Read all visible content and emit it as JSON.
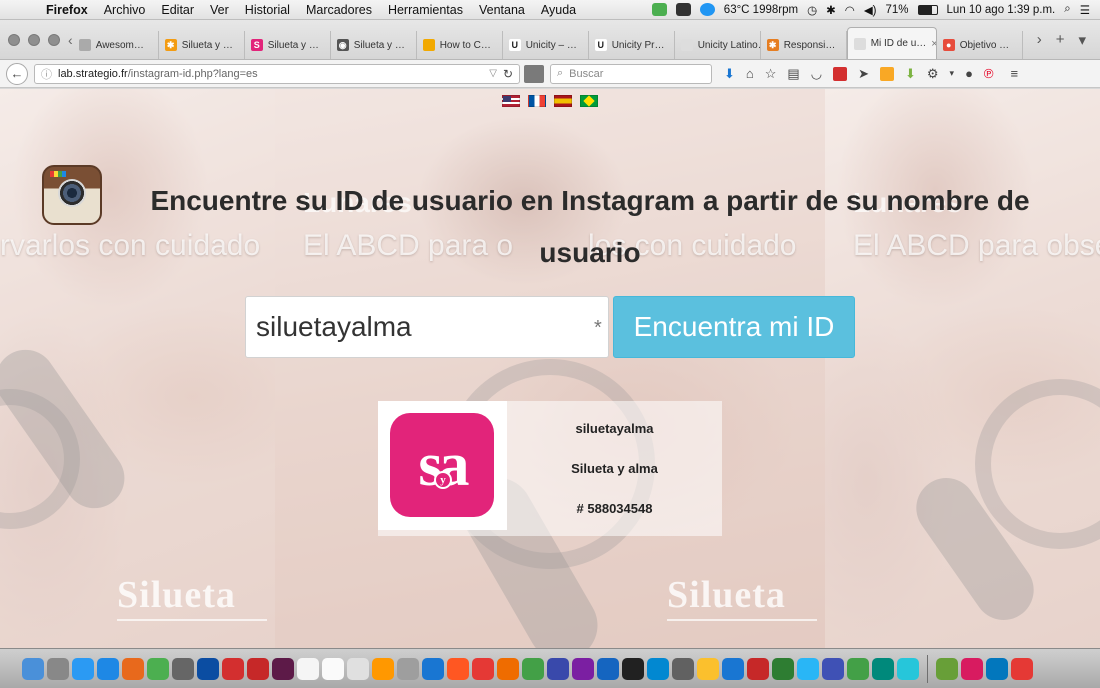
{
  "menubar": {
    "app": "Firefox",
    "items": [
      "Archivo",
      "Editar",
      "Ver",
      "Historial",
      "Marcadores",
      "Herramientas",
      "Ventana",
      "Ayuda"
    ],
    "temp": "63°C 1998rpm",
    "battery": "71%",
    "clock": "Lun 10 ago  1:39 p.m."
  },
  "tabs": [
    {
      "label": "Awesom…",
      "color": "#aaaaaa",
      "glyph": ""
    },
    {
      "label": "Silueta y …",
      "color": "#f39c12",
      "glyph": "✱"
    },
    {
      "label": "Silueta y …",
      "color": "#e2247a",
      "glyph": "S"
    },
    {
      "label": "Silueta y …",
      "color": "#555555",
      "glyph": "◉"
    },
    {
      "label": "How to C…",
      "color": "#f2a900",
      "glyph": ""
    },
    {
      "label": "Unicity – …",
      "color": "#ffffff",
      "glyph": "U"
    },
    {
      "label": "Unicity Pr…",
      "color": "#ffffff",
      "glyph": "U"
    },
    {
      "label": "Unicity Latino…",
      "color": "#dddddd",
      "glyph": ""
    },
    {
      "label": "Responsi…",
      "color": "#e67e22",
      "glyph": "✱"
    },
    {
      "label": "Mi ID de u…",
      "color": "#dddddd",
      "glyph": "",
      "active": true
    },
    {
      "label": "Objetivo …",
      "color": "#e74c3c",
      "glyph": "●"
    }
  ],
  "nav": {
    "url_host": "lab.strategio.fr",
    "url_path": "/instagram-id.php?lang=es",
    "search_placeholder": "Buscar"
  },
  "page": {
    "bg_word_left": "rvarlos con cuidado",
    "bg_word_mid": "El ABCD para o",
    "bg_word_mid2": "los con cuidado",
    "bg_word_right": "El ABCD para obse",
    "bg_title": "Lunares",
    "bg_logo": "Silueta",
    "headline_1": "Encuentre su ID de usuario en",
    "headline_brand": "Instagram",
    "headline_2": "a partir de su nombre de usuario",
    "input_value": "siluetayalma",
    "required_mark": "*",
    "button_label": "Encuentra mi ID",
    "result": {
      "username": "siluetayalma",
      "full_name": "Silueta y alma",
      "user_id": "# 588034548",
      "logo_text": "sa",
      "logo_y": "y"
    }
  },
  "dock": {
    "icons": [
      "#4a90d9",
      "#888888",
      "#2b9af3",
      "#1e88e5",
      "#e8691c",
      "#4caf50",
      "#666666",
      "#0b4da2",
      "#d32f2f",
      "#c62828",
      "#5d1a48",
      "#f5f5f5",
      "#fafafa",
      "#e0e0e0",
      "#ff9800",
      "#9e9e9e",
      "#1976d2",
      "#ff5722",
      "#e53935",
      "#ef6c00",
      "#43a047",
      "#3949ab",
      "#7b1fa2",
      "#1565c0",
      "#212121",
      "#0288d1",
      "#616161",
      "#fbc02d",
      "#1976d2",
      "#c62828",
      "#2e7d32",
      "#29b6f6",
      "#3f51b5",
      "#43a047",
      "#00897b",
      "#26c6da",
      "#689f38",
      "#d81b60",
      "#0277bd",
      "#e53935"
    ]
  }
}
